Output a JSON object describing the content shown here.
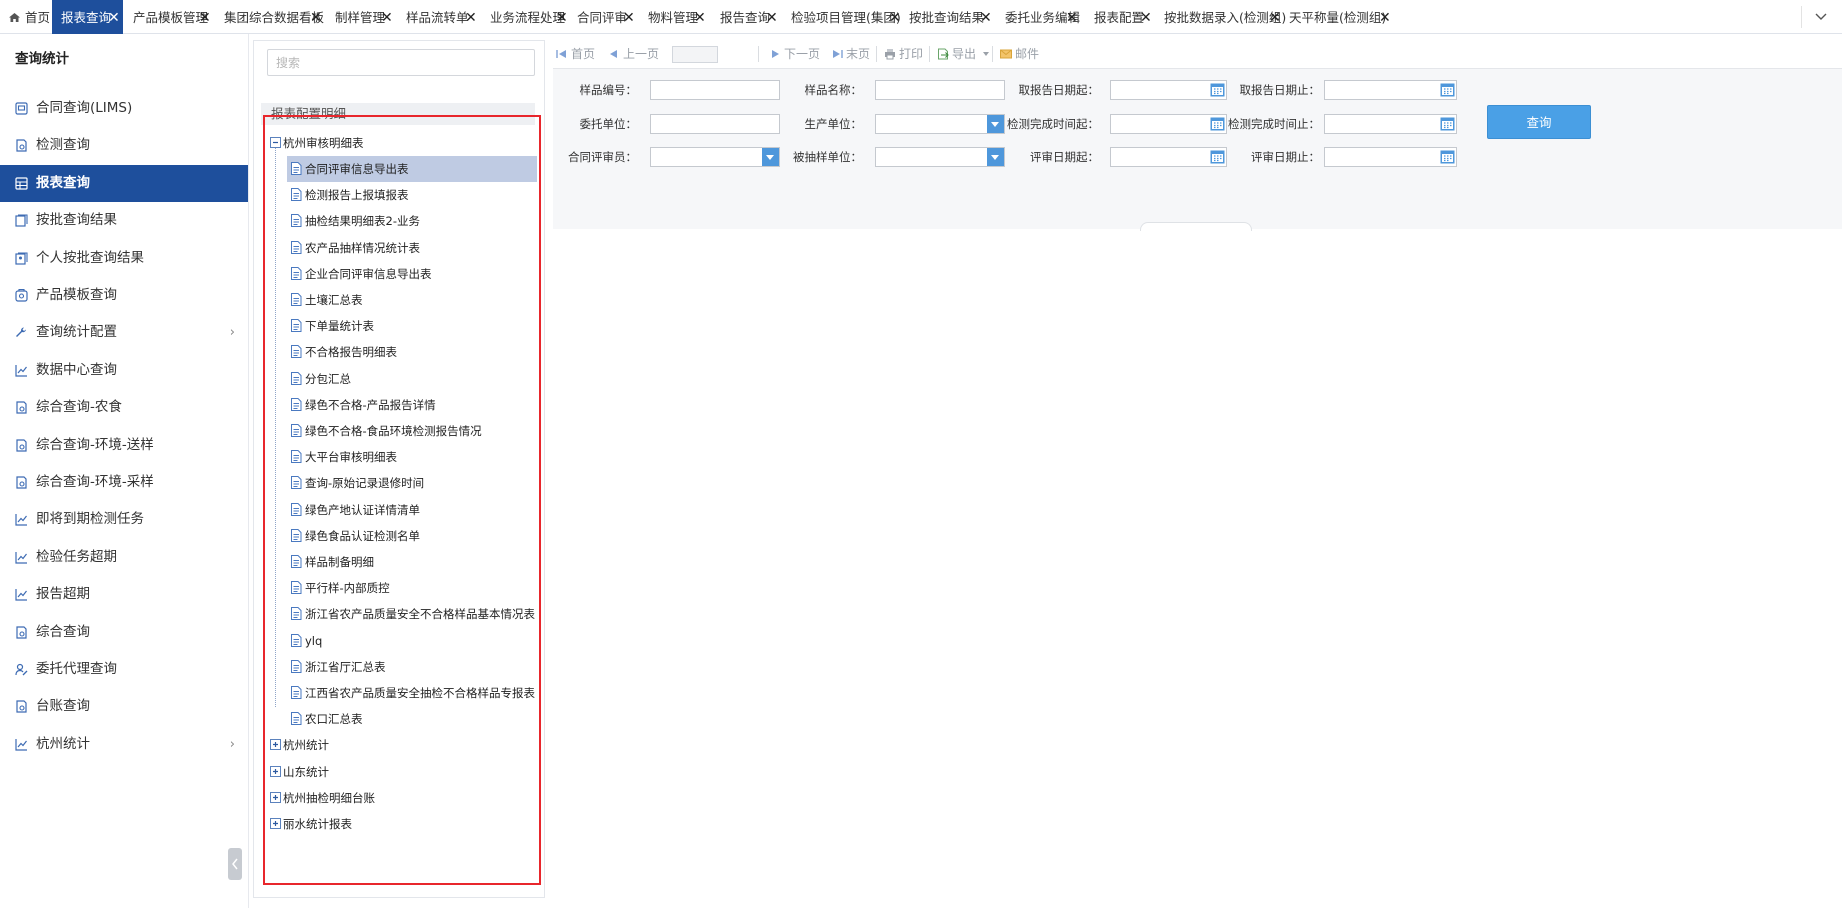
{
  "tabs": [
    {
      "label": "首页",
      "active": false,
      "closable": false,
      "icon": "home-icon"
    },
    {
      "label": "报表查询",
      "active": true,
      "closable": true
    },
    {
      "label": "产品模板管理",
      "active": false,
      "closable": true
    },
    {
      "label": "集团综合数据看板",
      "active": false,
      "closable": true
    },
    {
      "label": "制样管理",
      "active": false,
      "closable": true
    },
    {
      "label": "样品流转单",
      "active": false,
      "closable": true
    },
    {
      "label": "业务流程处理",
      "active": false,
      "closable": true
    },
    {
      "label": "合同评审",
      "active": false,
      "closable": true
    },
    {
      "label": "物料管理",
      "active": false,
      "closable": true
    },
    {
      "label": "报告查询",
      "active": false,
      "closable": true
    },
    {
      "label": "检验项目管理(集团)",
      "active": false,
      "closable": true
    },
    {
      "label": "按批查询结果",
      "active": false,
      "closable": true
    },
    {
      "label": "委托业务编辑",
      "active": false,
      "closable": true
    },
    {
      "label": "报表配置",
      "active": false,
      "closable": true
    },
    {
      "label": "按批数据录入(检测组)",
      "active": false,
      "closable": true
    },
    {
      "label": "天平称量(检测组)",
      "active": false,
      "closable": true
    }
  ],
  "tab_close_glyph": "✕",
  "nav": {
    "title": "查询统计",
    "items": [
      {
        "label": "合同查询(LIMS)",
        "icon": "contract-icon",
        "active": false,
        "has_sub": false
      },
      {
        "label": "检测查询",
        "icon": "report-icon",
        "active": false,
        "has_sub": false
      },
      {
        "label": "报表查询",
        "icon": "table-icon",
        "active": true,
        "has_sub": false
      },
      {
        "label": "按批查询结果",
        "icon": "batch-icon",
        "active": false,
        "has_sub": false
      },
      {
        "label": "个人按批查询结果",
        "icon": "user-batch-icon",
        "active": false,
        "has_sub": false
      },
      {
        "label": "产品模板查询",
        "icon": "template-icon",
        "active": false,
        "has_sub": false
      },
      {
        "label": "查询统计配置",
        "icon": "wrench-icon",
        "active": false,
        "has_sub": true
      },
      {
        "label": "数据中心查询",
        "icon": "chart-icon",
        "active": false,
        "has_sub": false
      },
      {
        "label": "综合查询-农食",
        "icon": "report-icon",
        "active": false,
        "has_sub": false
      },
      {
        "label": "综合查询-环境-送样",
        "icon": "report-icon",
        "active": false,
        "has_sub": false
      },
      {
        "label": "综合查询-环境-采样",
        "icon": "report-icon",
        "active": false,
        "has_sub": false
      },
      {
        "label": "即将到期检测任务",
        "icon": "chart-icon",
        "active": false,
        "has_sub": false
      },
      {
        "label": "检验任务超期",
        "icon": "chart-icon",
        "active": false,
        "has_sub": false
      },
      {
        "label": "报告超期",
        "icon": "chart-icon",
        "active": false,
        "has_sub": false
      },
      {
        "label": "综合查询",
        "icon": "report-icon",
        "active": false,
        "has_sub": false
      },
      {
        "label": "委托代理查询",
        "icon": "agent-icon",
        "active": false,
        "has_sub": false
      },
      {
        "label": "台账查询",
        "icon": "report-icon",
        "active": false,
        "has_sub": false
      },
      {
        "label": "杭州统计",
        "icon": "chart-icon",
        "active": false,
        "has_sub": true
      }
    ],
    "arrow_glyph": "›"
  },
  "tree": {
    "search_placeholder": "搜索",
    "header": "报表配置明细",
    "root_expanded": {
      "label": "杭州审核明细表"
    },
    "children": [
      {
        "label": "合同评审信息导出表",
        "selected": true
      },
      {
        "label": "检测报告上报填报表",
        "selected": false
      },
      {
        "label": "抽检结果明细表2-业务",
        "selected": false
      },
      {
        "label": "农产品抽样情况统计表",
        "selected": false
      },
      {
        "label": "企业合同评审信息导出表",
        "selected": false
      },
      {
        "label": "土壤汇总表",
        "selected": false
      },
      {
        "label": "下单量统计表",
        "selected": false
      },
      {
        "label": "不合格报告明细表",
        "selected": false
      },
      {
        "label": "分包汇总",
        "selected": false
      },
      {
        "label": "绿色不合格-产品报告详情",
        "selected": false
      },
      {
        "label": "绿色不合格-食品环境检测报告情况",
        "selected": false
      },
      {
        "label": "大平台审核明细表",
        "selected": false
      },
      {
        "label": "查询-原始记录退修时间",
        "selected": false
      },
      {
        "label": "绿色产地认证详情清单",
        "selected": false
      },
      {
        "label": "绿色食品认证检测名单",
        "selected": false
      },
      {
        "label": "样品制备明细",
        "selected": false
      },
      {
        "label": "平行样-内部质控",
        "selected": false
      },
      {
        "label": "浙江省农产品质量安全不合格样品基本情况表",
        "selected": false
      },
      {
        "label": "ylq",
        "selected": false
      },
      {
        "label": "浙江省厅汇总表",
        "selected": false
      },
      {
        "label": "江西省农产品质量安全抽检不合格样品专报表",
        "selected": false
      },
      {
        "label": "农口汇总表",
        "selected": false
      }
    ],
    "collapsed_roots": [
      {
        "label": "杭州统计"
      },
      {
        "label": "山东统计"
      },
      {
        "label": "杭州抽检明细台账"
      },
      {
        "label": "丽水统计报表"
      }
    ]
  },
  "toolbar": {
    "items": [
      {
        "label": "首页",
        "icon": "first-page-icon"
      },
      {
        "label": "上一页",
        "icon": "prev-page-icon"
      },
      {
        "label": "下一页",
        "icon": "next-page-icon"
      },
      {
        "label": "末页",
        "icon": "last-page-icon"
      },
      {
        "label": "打印",
        "icon": "print-icon"
      },
      {
        "label": "导出",
        "icon": "export-icon"
      },
      {
        "label": "邮件",
        "icon": "mail-icon"
      }
    ],
    "page_value": ""
  },
  "filters": [
    {
      "label": "样品编号：",
      "type": "text",
      "value": ""
    },
    {
      "label": "样品名称：",
      "type": "text",
      "value": ""
    },
    {
      "label": "取报告日期起：",
      "type": "date",
      "value": ""
    },
    {
      "label": "取报告日期止：",
      "type": "date",
      "value": ""
    },
    {
      "label": "委托单位：",
      "type": "text",
      "value": ""
    },
    {
      "label": "生产单位：",
      "type": "select",
      "value": ""
    },
    {
      "label": "检测完成时间起：",
      "type": "date",
      "value": ""
    },
    {
      "label": "检测完成时间止：",
      "type": "date",
      "value": ""
    },
    {
      "label": "合同评审员：",
      "type": "select",
      "value": ""
    },
    {
      "label": "被抽样单位：",
      "type": "select",
      "value": ""
    },
    {
      "label": "评审日期起：",
      "type": "date",
      "value": ""
    },
    {
      "label": "评审日期止：",
      "type": "date",
      "value": ""
    }
  ],
  "query_button": "查询",
  "colors": {
    "primary_nav": "#1e4f9c",
    "query_button": "#4aa0e6",
    "dropdown": "#4e97db",
    "highlight_border": "#e8262c",
    "selected_row": "#bfcbe3"
  }
}
